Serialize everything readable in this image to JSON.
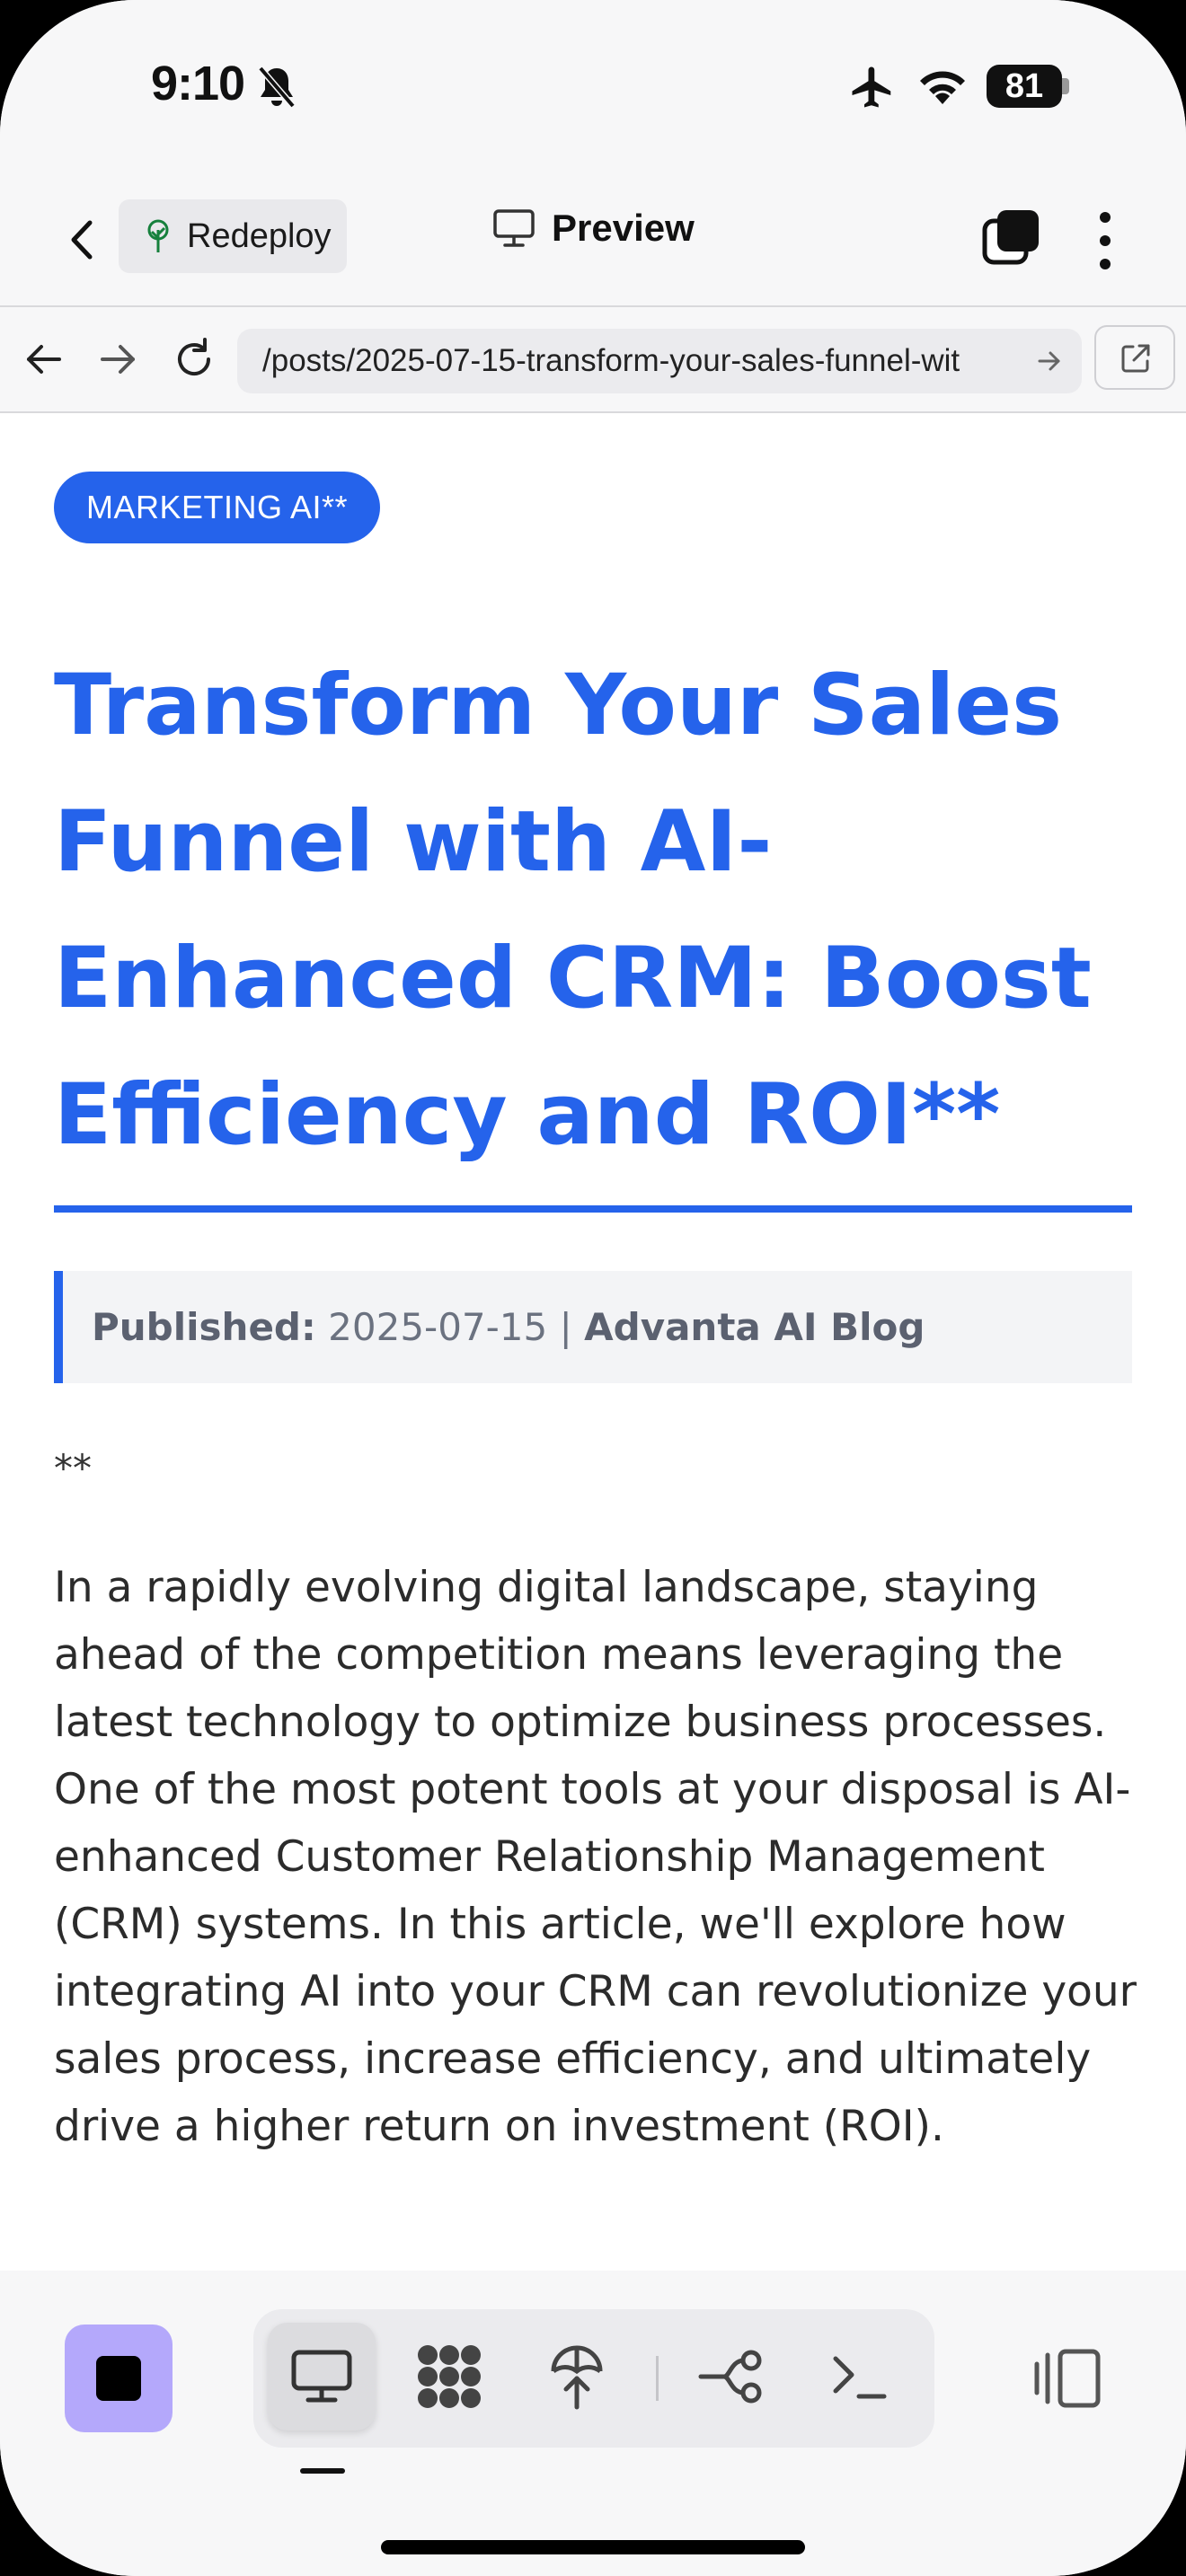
{
  "status_bar": {
    "time": "9:10",
    "battery": "81",
    "icons": [
      "bell-slash-icon",
      "airplane-icon",
      "wifi-icon",
      "battery-icon"
    ]
  },
  "header": {
    "redeploy_label": "Redeploy",
    "title": "Preview"
  },
  "browser": {
    "url": "/posts/2025-07-15-transform-your-sales-funnel-wit"
  },
  "article": {
    "category": "MARKETING AI**",
    "title": "Transform Your Sales Funnel with AI-Enhanced CRM: Boost Efficiency and ROI**",
    "meta": {
      "published_label": "Published:",
      "date": "2025-07-15",
      "separator": "|",
      "blog_name": "Advanta AI Blog"
    },
    "asterisks": "**",
    "intro": "In a rapidly evolving digital landscape, staying ahead of the competition means leveraging the latest technology to optimize business processes. One of the most potent tools at your disposal is AI-enhanced Customer Relationship Management (CRM) systems. In this article, we'll explore how integrating AI into your CRM can revolutionize your sales process, increase efficiency, and ultimately drive a higher return on investment (ROI)."
  },
  "toolbar": {
    "items": [
      "preview-icon",
      "apps-icon",
      "deploy-icon",
      "workflow-icon",
      "terminal-icon"
    ],
    "active": "preview-icon"
  },
  "colors": {
    "accent": "#2563eb",
    "stop_button": "#b4a8fb"
  }
}
